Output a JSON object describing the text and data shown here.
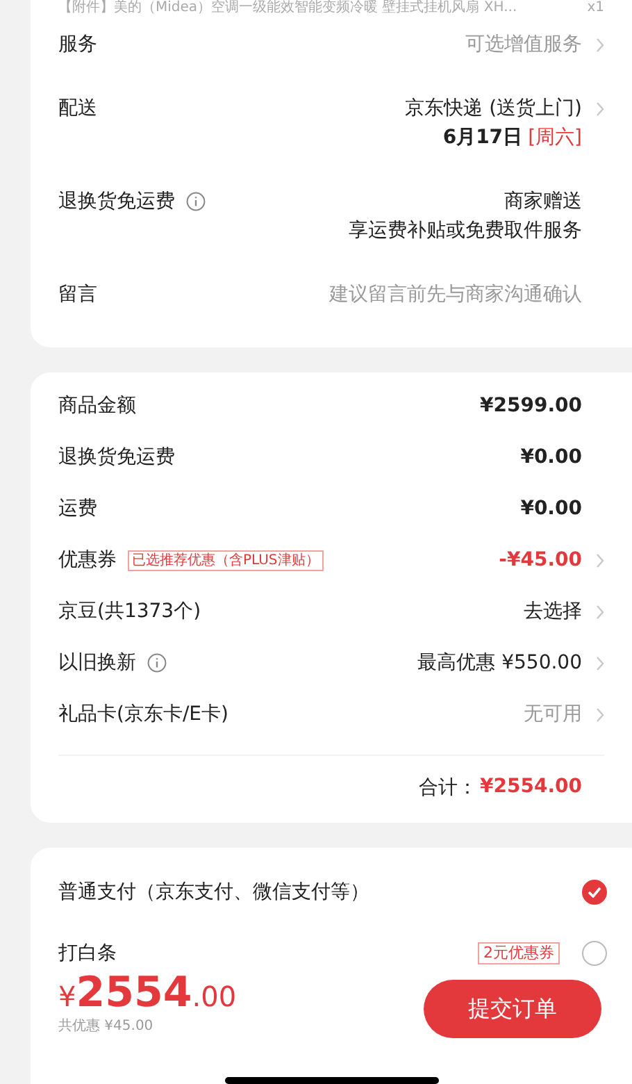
{
  "item_line": {
    "title": "【附件】美的（Midea）空调一级能效智能变频冷暖 壁挂式挂机风扇 XH...",
    "quantity": "x1"
  },
  "order_info": [
    {
      "label": "服务",
      "info": false,
      "chevron": true,
      "lines": [
        [
          {
            "text": "可选增值服务",
            "kind": "muted"
          }
        ]
      ]
    },
    {
      "label": "配送",
      "info": false,
      "chevron": true,
      "lines": [
        [
          {
            "text": "京东快递 (送货上门)",
            "kind": "normal"
          }
        ],
        [
          {
            "text": "6月17日",
            "kind": "strong"
          },
          {
            "text": "[周六]",
            "kind": "red"
          }
        ]
      ]
    },
    {
      "label": "退换货免运费",
      "info": true,
      "chevron": false,
      "lines": [
        [
          {
            "text": "商家赠送",
            "kind": "normal"
          }
        ],
        [
          {
            "text": "享运费补贴或免费取件服务",
            "kind": "normal"
          }
        ]
      ]
    },
    {
      "label": "留言",
      "info": false,
      "chevron": false,
      "lines": [
        [
          {
            "text": "建议留言前先与商家沟通确认",
            "kind": "muted"
          }
        ]
      ]
    }
  ],
  "costs": [
    {
      "label": "商品金额",
      "info": false,
      "value": "¥2599.00",
      "kind": "strong",
      "chevron": false
    },
    {
      "label": "退换货免运费",
      "info": false,
      "value": "¥0.00",
      "kind": "strong",
      "chevron": false
    },
    {
      "label": "运费",
      "info": false,
      "value": "¥0.00",
      "kind": "strong",
      "chevron": false
    },
    {
      "label": "优惠券",
      "info": false,
      "tag": "已选推荐优惠（含PLUS津贴）",
      "value": "-¥45.00",
      "kind": "red",
      "chevron": true
    },
    {
      "label": "京豆(共1373个)",
      "info": false,
      "value": "去选择",
      "kind": "normal",
      "chevron": true
    },
    {
      "label": "以旧换新",
      "info": true,
      "value": "最高优惠 ¥550.00",
      "kind": "normal",
      "chevron": true
    },
    {
      "label": "礼品卡(京东卡/E卡)",
      "info": false,
      "value": "无可用",
      "kind": "muted",
      "chevron": true
    }
  ],
  "total": {
    "label": "合计：",
    "value": "¥2554.00"
  },
  "payment_options": [
    {
      "label": "普通支付（京东支付、微信支付等）",
      "selected": true
    },
    {
      "label": "打白条",
      "selected": false,
      "badge": "2元优惠券"
    }
  ],
  "bottom_bar": {
    "currency": "¥",
    "amount": "2554",
    "decimals": ".00",
    "discount": "共优惠 ¥45.00",
    "submit": "提交订单"
  }
}
